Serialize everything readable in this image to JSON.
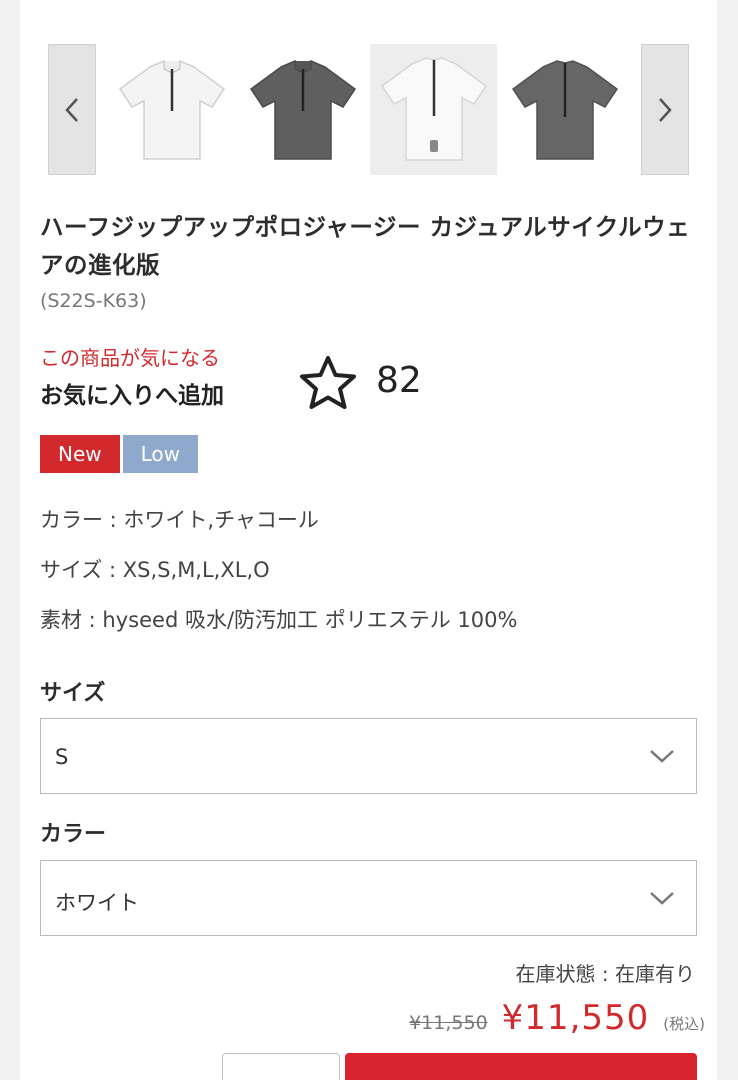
{
  "carousel": {
    "prev_icon": "chevron-left-icon",
    "next_icon": "chevron-right-icon",
    "thumbnails": [
      {
        "label": "white-jersey-front"
      },
      {
        "label": "charcoal-jersey-front"
      },
      {
        "label": "white-jersey-back"
      },
      {
        "label": "charcoal-jersey-back"
      }
    ]
  },
  "product": {
    "title": "ハーフジップアップポロジャージー カジュアルサイクルウェアの進化版",
    "sku": "(S22S-K63)"
  },
  "favorite": {
    "note": "この商品が気になる",
    "add_label": "お気に入りへ追加",
    "count": "82",
    "icon": "star-outline-icon"
  },
  "badges": {
    "new": "New",
    "low": "Low"
  },
  "specs": {
    "color": "カラー : ホワイト,チャコール",
    "size": "サイズ : XS,S,M,L,XL,O",
    "material": "素材 : hyseed 吸水/防汚加工 ポリエステル 100%"
  },
  "size_field": {
    "label": "サイズ",
    "value": "S"
  },
  "color_field": {
    "label": "カラー",
    "value": "ホワイト"
  },
  "stock": "在庫状態 : 在庫有り",
  "pricing": {
    "old_price": "¥11,550",
    "price": "¥11,550",
    "tax_note": "(税込)"
  },
  "colors": {
    "accent_red": "#d2292d",
    "badge_low": "#8ea9cc"
  }
}
